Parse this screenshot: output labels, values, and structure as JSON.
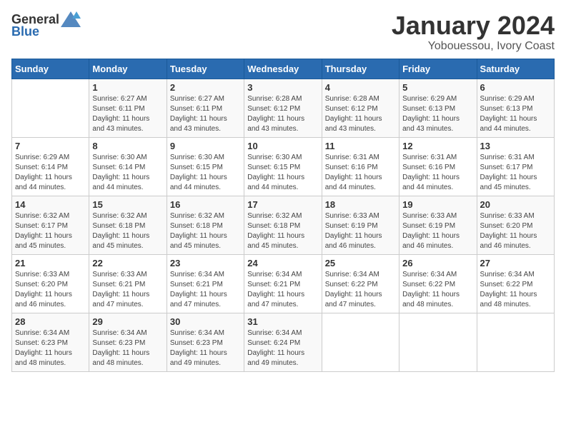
{
  "logo": {
    "general": "General",
    "blue": "Blue"
  },
  "title": "January 2024",
  "subtitle": "Yobouessou, Ivory Coast",
  "days_header": [
    "Sunday",
    "Monday",
    "Tuesday",
    "Wednesday",
    "Thursday",
    "Friday",
    "Saturday"
  ],
  "weeks": [
    [
      {
        "day": "",
        "sunrise": "",
        "sunset": "",
        "daylight": ""
      },
      {
        "day": "1",
        "sunrise": "Sunrise: 6:27 AM",
        "sunset": "Sunset: 6:11 PM",
        "daylight": "Daylight: 11 hours and 43 minutes."
      },
      {
        "day": "2",
        "sunrise": "Sunrise: 6:27 AM",
        "sunset": "Sunset: 6:11 PM",
        "daylight": "Daylight: 11 hours and 43 minutes."
      },
      {
        "day": "3",
        "sunrise": "Sunrise: 6:28 AM",
        "sunset": "Sunset: 6:12 PM",
        "daylight": "Daylight: 11 hours and 43 minutes."
      },
      {
        "day": "4",
        "sunrise": "Sunrise: 6:28 AM",
        "sunset": "Sunset: 6:12 PM",
        "daylight": "Daylight: 11 hours and 43 minutes."
      },
      {
        "day": "5",
        "sunrise": "Sunrise: 6:29 AM",
        "sunset": "Sunset: 6:13 PM",
        "daylight": "Daylight: 11 hours and 43 minutes."
      },
      {
        "day": "6",
        "sunrise": "Sunrise: 6:29 AM",
        "sunset": "Sunset: 6:13 PM",
        "daylight": "Daylight: 11 hours and 44 minutes."
      }
    ],
    [
      {
        "day": "7",
        "sunrise": "Sunrise: 6:29 AM",
        "sunset": "Sunset: 6:14 PM",
        "daylight": "Daylight: 11 hours and 44 minutes."
      },
      {
        "day": "8",
        "sunrise": "Sunrise: 6:30 AM",
        "sunset": "Sunset: 6:14 PM",
        "daylight": "Daylight: 11 hours and 44 minutes."
      },
      {
        "day": "9",
        "sunrise": "Sunrise: 6:30 AM",
        "sunset": "Sunset: 6:15 PM",
        "daylight": "Daylight: 11 hours and 44 minutes."
      },
      {
        "day": "10",
        "sunrise": "Sunrise: 6:30 AM",
        "sunset": "Sunset: 6:15 PM",
        "daylight": "Daylight: 11 hours and 44 minutes."
      },
      {
        "day": "11",
        "sunrise": "Sunrise: 6:31 AM",
        "sunset": "Sunset: 6:16 PM",
        "daylight": "Daylight: 11 hours and 44 minutes."
      },
      {
        "day": "12",
        "sunrise": "Sunrise: 6:31 AM",
        "sunset": "Sunset: 6:16 PM",
        "daylight": "Daylight: 11 hours and 44 minutes."
      },
      {
        "day": "13",
        "sunrise": "Sunrise: 6:31 AM",
        "sunset": "Sunset: 6:17 PM",
        "daylight": "Daylight: 11 hours and 45 minutes."
      }
    ],
    [
      {
        "day": "14",
        "sunrise": "Sunrise: 6:32 AM",
        "sunset": "Sunset: 6:17 PM",
        "daylight": "Daylight: 11 hours and 45 minutes."
      },
      {
        "day": "15",
        "sunrise": "Sunrise: 6:32 AM",
        "sunset": "Sunset: 6:18 PM",
        "daylight": "Daylight: 11 hours and 45 minutes."
      },
      {
        "day": "16",
        "sunrise": "Sunrise: 6:32 AM",
        "sunset": "Sunset: 6:18 PM",
        "daylight": "Daylight: 11 hours and 45 minutes."
      },
      {
        "day": "17",
        "sunrise": "Sunrise: 6:32 AM",
        "sunset": "Sunset: 6:18 PM",
        "daylight": "Daylight: 11 hours and 45 minutes."
      },
      {
        "day": "18",
        "sunrise": "Sunrise: 6:33 AM",
        "sunset": "Sunset: 6:19 PM",
        "daylight": "Daylight: 11 hours and 46 minutes."
      },
      {
        "day": "19",
        "sunrise": "Sunrise: 6:33 AM",
        "sunset": "Sunset: 6:19 PM",
        "daylight": "Daylight: 11 hours and 46 minutes."
      },
      {
        "day": "20",
        "sunrise": "Sunrise: 6:33 AM",
        "sunset": "Sunset: 6:20 PM",
        "daylight": "Daylight: 11 hours and 46 minutes."
      }
    ],
    [
      {
        "day": "21",
        "sunrise": "Sunrise: 6:33 AM",
        "sunset": "Sunset: 6:20 PM",
        "daylight": "Daylight: 11 hours and 46 minutes."
      },
      {
        "day": "22",
        "sunrise": "Sunrise: 6:33 AM",
        "sunset": "Sunset: 6:21 PM",
        "daylight": "Daylight: 11 hours and 47 minutes."
      },
      {
        "day": "23",
        "sunrise": "Sunrise: 6:34 AM",
        "sunset": "Sunset: 6:21 PM",
        "daylight": "Daylight: 11 hours and 47 minutes."
      },
      {
        "day": "24",
        "sunrise": "Sunrise: 6:34 AM",
        "sunset": "Sunset: 6:21 PM",
        "daylight": "Daylight: 11 hours and 47 minutes."
      },
      {
        "day": "25",
        "sunrise": "Sunrise: 6:34 AM",
        "sunset": "Sunset: 6:22 PM",
        "daylight": "Daylight: 11 hours and 47 minutes."
      },
      {
        "day": "26",
        "sunrise": "Sunrise: 6:34 AM",
        "sunset": "Sunset: 6:22 PM",
        "daylight": "Daylight: 11 hours and 48 minutes."
      },
      {
        "day": "27",
        "sunrise": "Sunrise: 6:34 AM",
        "sunset": "Sunset: 6:22 PM",
        "daylight": "Daylight: 11 hours and 48 minutes."
      }
    ],
    [
      {
        "day": "28",
        "sunrise": "Sunrise: 6:34 AM",
        "sunset": "Sunset: 6:23 PM",
        "daylight": "Daylight: 11 hours and 48 minutes."
      },
      {
        "day": "29",
        "sunrise": "Sunrise: 6:34 AM",
        "sunset": "Sunset: 6:23 PM",
        "daylight": "Daylight: 11 hours and 48 minutes."
      },
      {
        "day": "30",
        "sunrise": "Sunrise: 6:34 AM",
        "sunset": "Sunset: 6:23 PM",
        "daylight": "Daylight: 11 hours and 49 minutes."
      },
      {
        "day": "31",
        "sunrise": "Sunrise: 6:34 AM",
        "sunset": "Sunset: 6:24 PM",
        "daylight": "Daylight: 11 hours and 49 minutes."
      },
      {
        "day": "",
        "sunrise": "",
        "sunset": "",
        "daylight": ""
      },
      {
        "day": "",
        "sunrise": "",
        "sunset": "",
        "daylight": ""
      },
      {
        "day": "",
        "sunrise": "",
        "sunset": "",
        "daylight": ""
      }
    ]
  ]
}
